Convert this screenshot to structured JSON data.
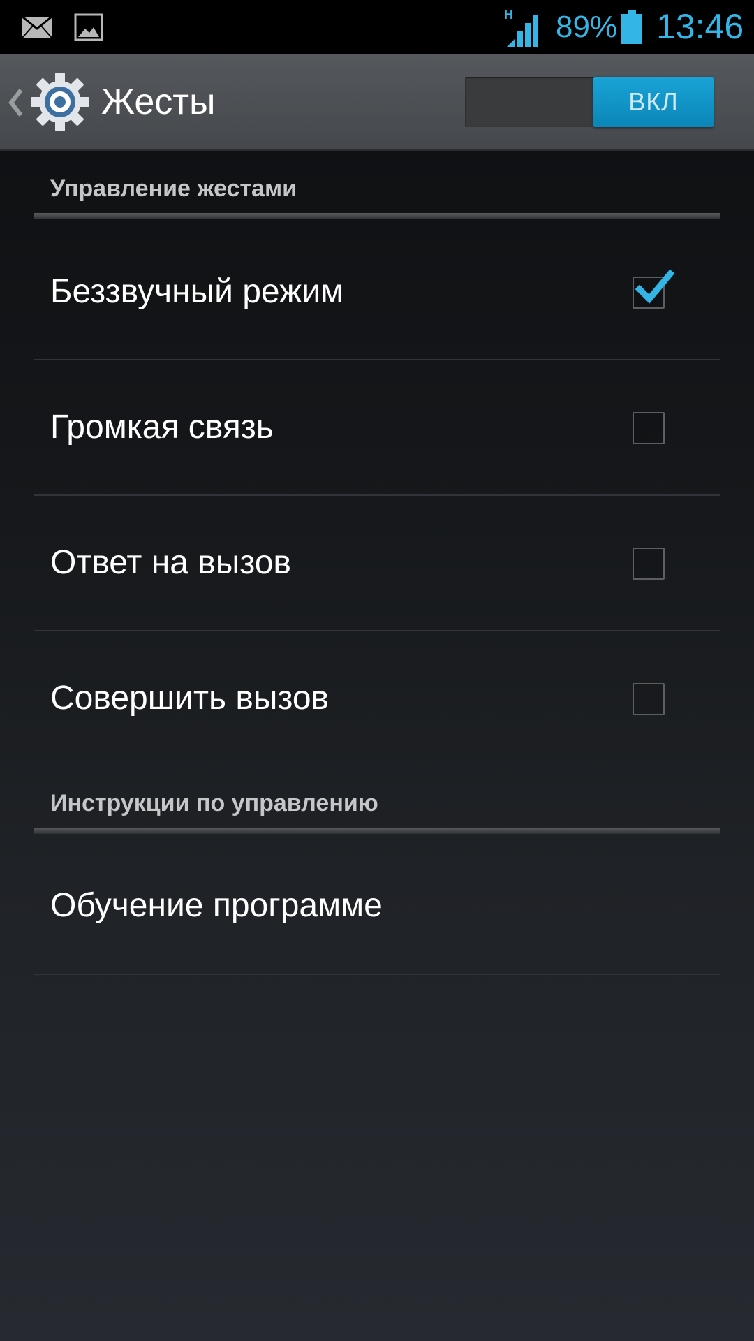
{
  "status_bar": {
    "icons": [
      "mail-icon",
      "gallery-icon",
      "signal-hspa-icon",
      "battery-icon"
    ],
    "network_type": "H",
    "battery_percent": "89%",
    "time": "13:46",
    "accent_color": "#33b5e5"
  },
  "action_bar": {
    "title": "Жесты",
    "switch_label": "ВКЛ",
    "switch_state": "on",
    "icons": [
      "back-caret-icon",
      "settings-gear-icon"
    ]
  },
  "categories": [
    {
      "title": "Управление жестами",
      "items": [
        {
          "label": "Беззвучный режим",
          "checked": true
        },
        {
          "label": "Громкая связь",
          "checked": false
        },
        {
          "label": "Ответ на вызов",
          "checked": false
        },
        {
          "label": "Совершить вызов",
          "checked": false
        }
      ]
    },
    {
      "title": "Инструкции по управлению",
      "items": [
        {
          "label": "Обучение программе"
        }
      ]
    }
  ]
}
